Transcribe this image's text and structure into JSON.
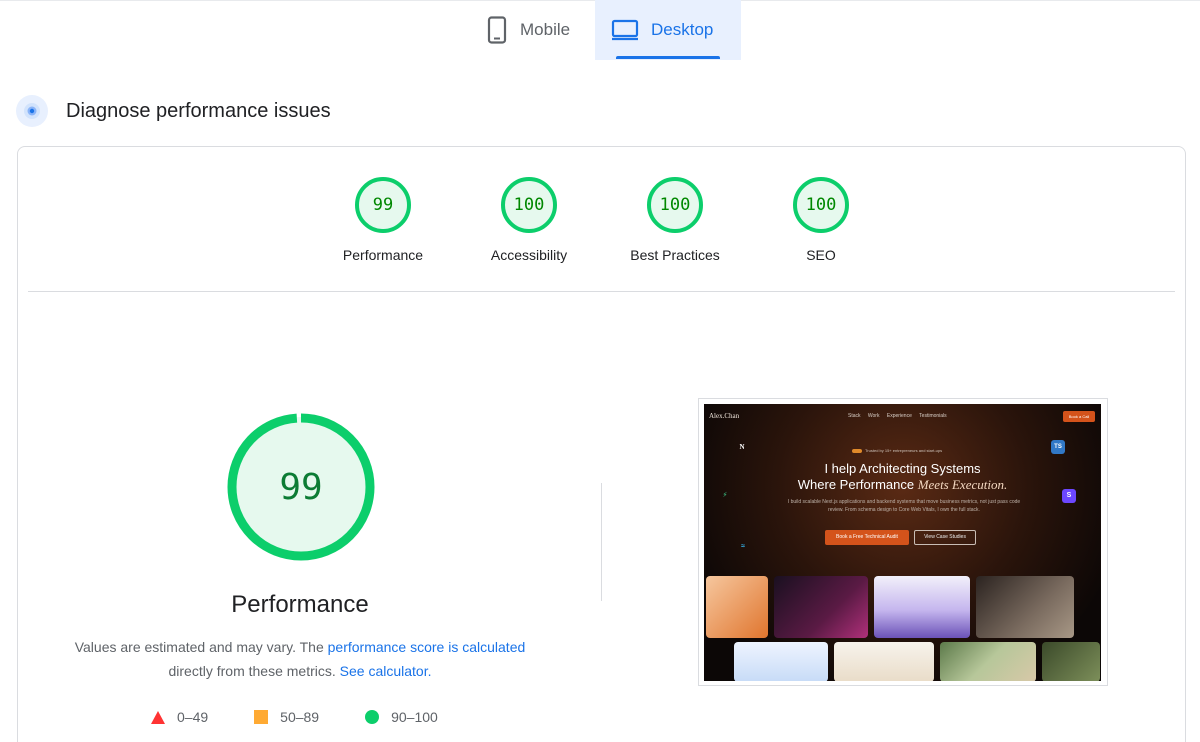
{
  "tabs": [
    {
      "label": "Mobile",
      "icon": "smartphone-icon",
      "active": false
    },
    {
      "label": "Desktop",
      "icon": "desktop-icon",
      "active": true
    }
  ],
  "section": {
    "title": "Diagnose performance issues",
    "icon": "lighthouse-icon"
  },
  "categories": [
    {
      "score": "99",
      "label": "Performance"
    },
    {
      "score": "100",
      "label": "Accessibility"
    },
    {
      "score": "100",
      "label": "Best Practices"
    },
    {
      "score": "100",
      "label": "SEO"
    }
  ],
  "main_gauge": {
    "score": "99",
    "title": "Performance",
    "fraction": 0.99
  },
  "description": {
    "text_before": "Values are estimated and may vary. The ",
    "link1": "performance score is calculated",
    "text_middle": " directly from these metrics.",
    "link2": "See calculator."
  },
  "legend": [
    {
      "range": "0–49",
      "shape": "triangle",
      "color": "#ff3333"
    },
    {
      "range": "50–89",
      "shape": "square",
      "color": "#ffaa33"
    },
    {
      "range": "90–100",
      "shape": "circle",
      "color": "#0cce6b"
    }
  ],
  "colors": {
    "pass": "#0cce6b",
    "pass_bg": "#e6f9ee",
    "pass_text": "#008800",
    "accent": "#1a73e8"
  },
  "screenshot": {
    "brand": "Alex.Chan",
    "nav_links": "Stack Work Experience Testimonials",
    "nav_cta": "Book a Call",
    "trust": "Trusted by 15+ entrepreneurs and start-ups",
    "headline_line1": "I help Architecting Systems",
    "headline_line2_plain": "Where Performance ",
    "headline_line2_italic": "Meets Execution.",
    "subtext": "I build scalable Next.js applications and backend systems that move business metrics, not just pass code review. From schema design to Core Web Vitals, I own the full stack.",
    "primary_cta": "Book a Free Technical Audit",
    "secondary_cta": "View Case Studies"
  }
}
